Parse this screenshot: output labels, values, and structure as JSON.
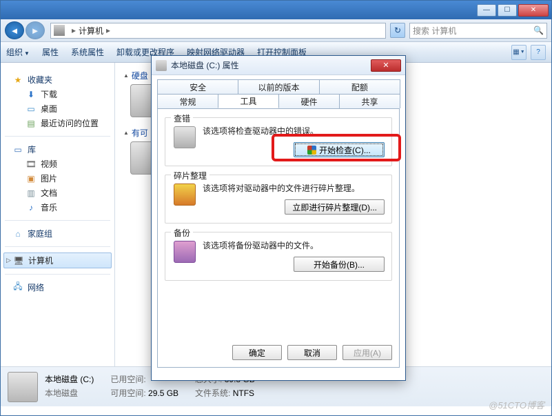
{
  "explorer": {
    "breadcrumb": {
      "root": "计算机"
    },
    "search_placeholder": "搜索 计算机",
    "toolbar": {
      "organize": "组织",
      "properties": "属性",
      "sys_properties": "系统属性",
      "uninstall": "卸载或更改程序",
      "map_drive": "映射网络驱动器",
      "control_panel": "打开控制面板"
    },
    "sidebar": {
      "favorites": "收藏夹",
      "downloads": "下载",
      "desktop": "桌面",
      "recent": "最近访问的位置",
      "libraries": "库",
      "videos": "视频",
      "pictures": "图片",
      "documents": "文档",
      "music": "音乐",
      "homegroup": "家庭组",
      "computer": "计算机",
      "network": "网络"
    },
    "main": {
      "hard_drives": "硬盘",
      "removable": "有可"
    },
    "details": {
      "name": "本地磁盘 (C:)",
      "type": "本地磁盘",
      "used_label": "已用空间:",
      "free_label": "可用空间:",
      "free_value": "29.5 GB",
      "total_label": "总大小:",
      "total_value": "39.8 GB",
      "fs_label": "文件系统:",
      "fs_value": "NTFS"
    }
  },
  "dialog": {
    "title": "本地磁盘 (C:) 属性",
    "tabs_top": [
      "安全",
      "以前的版本",
      "配额"
    ],
    "tabs_bottom": [
      "常规",
      "工具",
      "硬件",
      "共享"
    ],
    "active_tab": "工具",
    "check": {
      "legend": "查错",
      "desc": "该选项将检查驱动器中的错误。",
      "button": "开始检查(C)..."
    },
    "defrag": {
      "legend": "碎片整理",
      "desc": "该选项将对驱动器中的文件进行碎片整理。",
      "button": "立即进行碎片整理(D)..."
    },
    "backup": {
      "legend": "备份",
      "desc": "该选项将备份驱动器中的文件。",
      "button": "开始备份(B)..."
    },
    "footer": {
      "ok": "确定",
      "cancel": "取消",
      "apply": "应用(A)"
    }
  },
  "watermark": "@51CTO博客"
}
